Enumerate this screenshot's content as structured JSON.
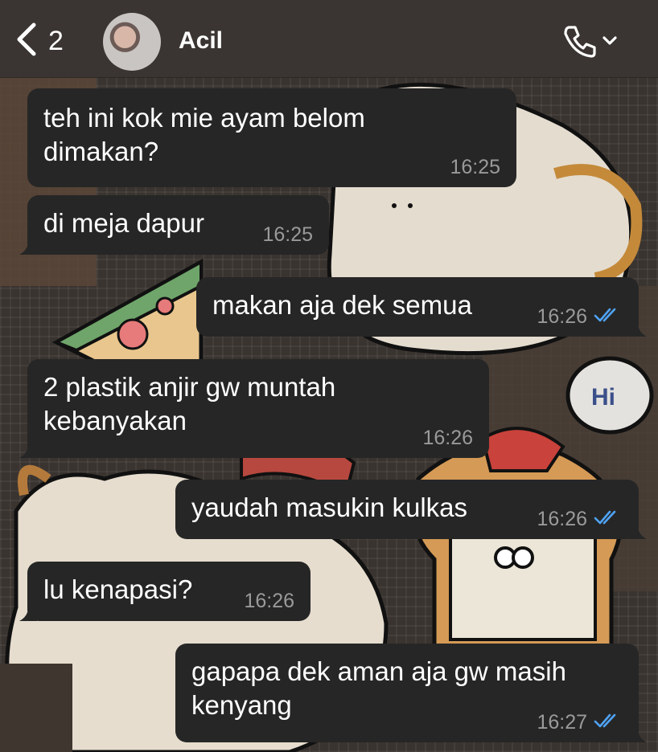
{
  "header": {
    "back_count": "2",
    "contact_name": "Acil",
    "icons": [
      "chevron-left-icon",
      "phone-icon",
      "chevron-down-icon"
    ]
  },
  "colors": {
    "header_bg": "#3a3532",
    "bubble_bg": "#262626",
    "timestamp": "#9a9a9a",
    "read_ticks": "#4fa3f7"
  },
  "messages": [
    {
      "direction": "in",
      "lines": [
        "teh ini kok mie ayam belom",
        "dimakan?"
      ],
      "time": "16:25"
    },
    {
      "direction": "in",
      "lines": [
        "di meja dapur"
      ],
      "time": "16:25"
    },
    {
      "direction": "out",
      "lines": [
        "makan aja dek semua"
      ],
      "time": "16:26",
      "status": "read"
    },
    {
      "direction": "in",
      "lines": [
        "2 plastik anjir gw muntah",
        "kebanyakan"
      ],
      "time": "16:26"
    },
    {
      "direction": "out",
      "lines": [
        "yaudah masukin kulkas"
      ],
      "time": "16:26",
      "status": "read"
    },
    {
      "direction": "in",
      "lines": [
        "lu kenapasi?"
      ],
      "time": "16:26"
    },
    {
      "direction": "out",
      "lines": [
        "gapapa dek aman aja gw masih",
        "kenyang"
      ],
      "time": "16:27",
      "status": "read"
    }
  ],
  "wallpaper": {
    "sticker_text": "Hi"
  }
}
